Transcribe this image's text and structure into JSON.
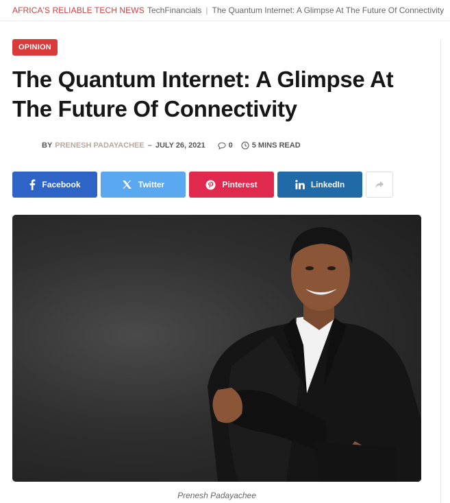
{
  "topbar": {
    "site_tag": "AFRICA'S RELIABLE TECH NEWS",
    "crumb_site": "TechFinancials",
    "crumb_separator": "|",
    "crumb_article": "The Quantum Internet: A Glimpse At The Future Of Connectivity"
  },
  "article": {
    "category": "OPINION",
    "title": "The Quantum Internet: A Glimpse At The Future Of Connectivity",
    "by_label": "BY",
    "author": "PRENESH PADAYACHEE",
    "dash": "–",
    "date": "JULY 26, 2021",
    "comments": "0",
    "read_time": "5 MINS READ"
  },
  "share": {
    "facebook": "Facebook",
    "twitter": "Twitter",
    "pinterest": "Pinterest",
    "linkedin": "LinkedIn"
  },
  "hero": {
    "caption": "Prenesh Padayachee"
  },
  "colors": {
    "accent": "#d93b3b",
    "facebook": "#2f64c7",
    "twitter": "#59a8f0",
    "pinterest": "#df2a4e",
    "linkedin": "#1f6aa7"
  }
}
